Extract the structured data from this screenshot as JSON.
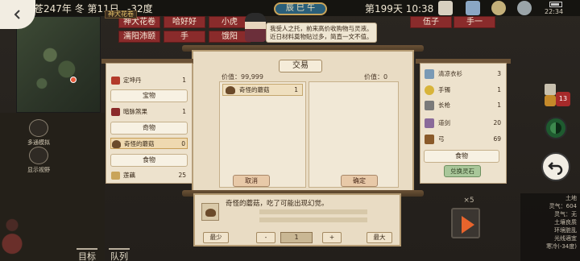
{
  "topbar": {
    "date": "天苍247年 冬 第11日",
    "temperature": "-32度",
    "day_time": "第199天 10:38",
    "clock": "22:34",
    "shichen": "辰 巳 午"
  },
  "chips": {
    "row1": [
      "神犬花卷",
      "哈好好",
      "小虎",
      "伍子",
      "手一"
    ],
    "row2": [
      "濡阳沛颐",
      "手",
      "饿阳"
    ],
    "small_label": "神犬花卷"
  },
  "npc": {
    "speech": "我受人之托，前来高价收购物与灵液。近日材料奠物贴过多，简直一文不值。"
  },
  "trade": {
    "title": "交易",
    "left_price": "价值：99,999",
    "right_price": "价值：0",
    "offer": {
      "name": "奇怪的蘑菇",
      "qty": "1"
    },
    "cancel_label": "取消",
    "confirm_label": "确定"
  },
  "player_inventory": {
    "items_top": [
      {
        "name": "定坤丹",
        "qty": "1",
        "color": "#b33a2a"
      }
    ],
    "cat_treasure": "宝物",
    "treasure_items": [
      {
        "name": "暗脉煞果",
        "qty": "1",
        "color": "#8a2a2a"
      }
    ],
    "cat_strange": "奇物",
    "strange_items": [
      {
        "name": "奇怪的蘑菇",
        "qty": "0",
        "color": "#6b4a2a"
      }
    ],
    "cat_food": "食物",
    "food_items": [
      {
        "name": "莲藕",
        "qty": "25",
        "color": "#c9a45a"
      }
    ]
  },
  "merchant_inventory": {
    "items": [
      {
        "name": "清凉衣衫",
        "qty": "3",
        "color": "#7a9ab5"
      },
      {
        "name": "手镯",
        "qty": "1",
        "color": "#d8b43a"
      },
      {
        "name": "长枪",
        "qty": "1",
        "color": "#7a7a7a"
      },
      {
        "name": "道剑",
        "qty": "20",
        "color": "#8a6a9a"
      },
      {
        "name": "弓",
        "qty": "69",
        "color": "#8a5a2a"
      }
    ],
    "cat_food": "食物",
    "button_label": "兑换灵石"
  },
  "detail": {
    "text": "奇怪的蘑菇，吃了可能出现幻觉。",
    "qty_min_label": "最少",
    "qty_minus_label": "-",
    "qty_value": "1",
    "qty_plus_label": "+",
    "qty_max_label": "最大"
  },
  "side_menus": {
    "item1": "多通模拟",
    "item2": "显示视野",
    "bottom1": "目标",
    "bottom2": "队列"
  },
  "hud": {
    "badge_count": "13",
    "speed": "×5",
    "env": [
      "土地",
      "灵气：604",
      "灵气：无",
      "土壤良质",
      "环境脏乱",
      "光线適宜",
      "寒冷(-34度)"
    ]
  },
  "colors": {
    "panel_bg": "#e9dcc4",
    "panel_border": "#b59c74",
    "accent_red": "#8a2b2b",
    "play_orange": "#e8642c"
  }
}
